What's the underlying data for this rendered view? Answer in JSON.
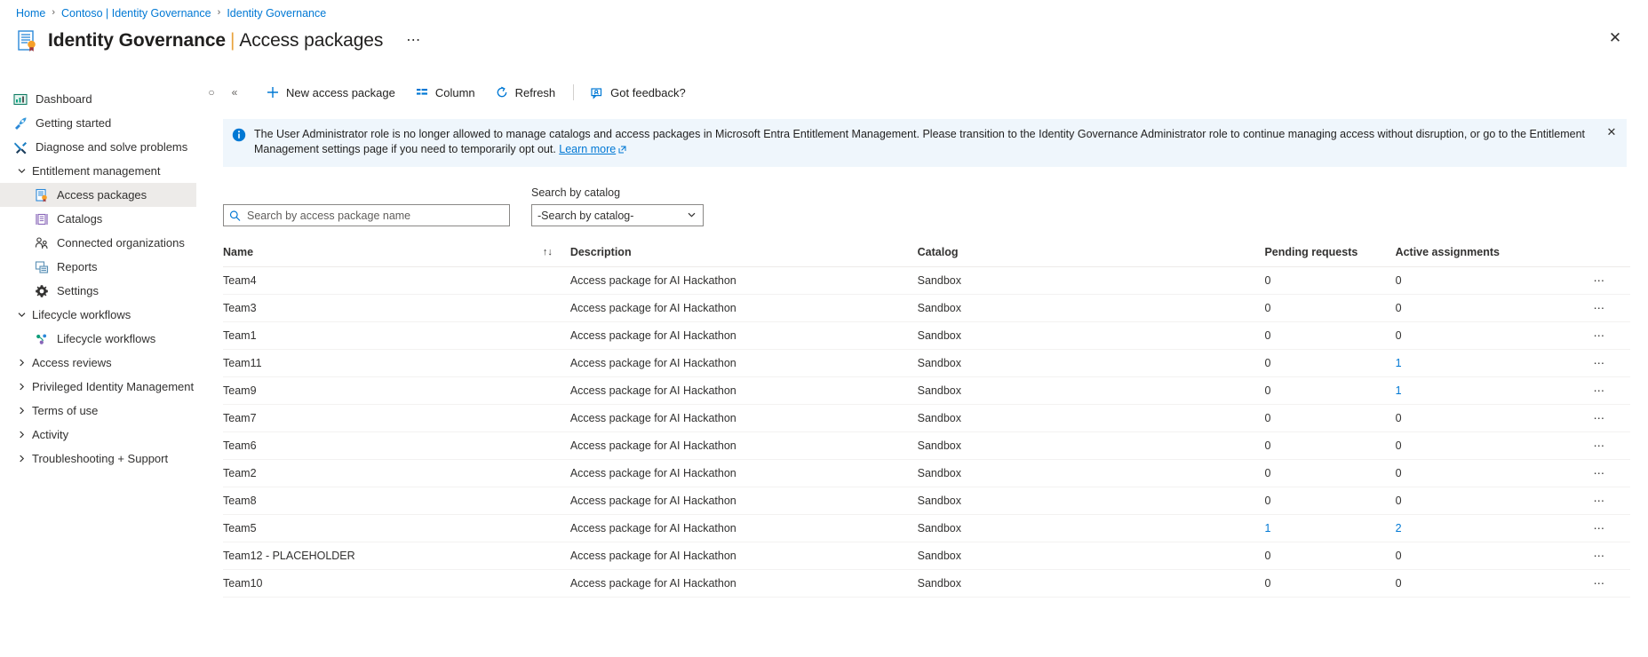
{
  "breadcrumb": {
    "items": [
      {
        "label": "Home"
      },
      {
        "label": "Contoso | Identity Governance"
      },
      {
        "label": "Identity Governance"
      }
    ],
    "separator": "›"
  },
  "header": {
    "title_main": "Identity Governance",
    "title_separator": "|",
    "title_sub": "Access packages",
    "overflow_label": "⋯",
    "close_label": "✕",
    "icon": "access-package-icon"
  },
  "sidebar": {
    "collapse_label": "«",
    "pin_label": "○",
    "items": [
      {
        "label": "Dashboard",
        "icon": "dashboard-icon",
        "type": "item",
        "selected": false
      },
      {
        "label": "Getting started",
        "icon": "rocket-icon",
        "type": "item",
        "selected": false
      },
      {
        "label": "Diagnose and solve problems",
        "icon": "tools-icon",
        "type": "item",
        "selected": false
      },
      {
        "label": "Entitlement management",
        "icon": "chevron-down-icon",
        "type": "group-open",
        "selected": false
      },
      {
        "label": "Access packages",
        "icon": "access-package-icon",
        "type": "child",
        "selected": true
      },
      {
        "label": "Catalogs",
        "icon": "catalog-icon",
        "type": "child",
        "selected": false
      },
      {
        "label": "Connected organizations",
        "icon": "people-icon",
        "type": "child",
        "selected": false
      },
      {
        "label": "Reports",
        "icon": "reports-icon",
        "type": "child",
        "selected": false
      },
      {
        "label": "Settings",
        "icon": "gear-icon",
        "type": "child",
        "selected": false
      },
      {
        "label": "Lifecycle workflows",
        "icon": "chevron-down-icon",
        "type": "group-open",
        "selected": false
      },
      {
        "label": "Lifecycle workflows",
        "icon": "workflow-icon",
        "type": "child",
        "selected": false
      },
      {
        "label": "Access reviews",
        "icon": "chevron-right-icon",
        "type": "group-closed",
        "selected": false
      },
      {
        "label": "Privileged Identity Management",
        "icon": "chevron-right-icon",
        "type": "group-closed",
        "selected": false
      },
      {
        "label": "Terms of use",
        "icon": "chevron-right-icon",
        "type": "group-closed",
        "selected": false
      },
      {
        "label": "Activity",
        "icon": "chevron-right-icon",
        "type": "group-closed",
        "selected": false
      },
      {
        "label": "Troubleshooting + Support",
        "icon": "chevron-right-icon",
        "type": "group-closed",
        "selected": false
      }
    ]
  },
  "toolbar": {
    "new_package_label": "New access package",
    "column_label": "Column",
    "refresh_label": "Refresh",
    "feedback_label": "Got feedback?"
  },
  "banner": {
    "text_part1": "The User Administrator role is no longer allowed to manage catalogs and access packages in Microsoft Entra Entitlement Management. Please transition to the Identity Governance Administrator role to continue managing access without disruption, or go to the Entitlement Management settings page if you need to temporarily opt out. ",
    "link_label": "Learn more",
    "close_label": "✕",
    "background": "#eff6fc",
    "accent": "#0078d4"
  },
  "filters": {
    "search_placeholder": "Search by access package name",
    "search_value": "",
    "catalog_label": "Search by catalog",
    "catalog_selected": "-Search by catalog-",
    "catalog_options": [
      "-Search by catalog-",
      "Sandbox"
    ]
  },
  "table": {
    "columns": [
      {
        "key": "name",
        "label": "Name",
        "sortable": true,
        "sort_icon": "↑↓"
      },
      {
        "key": "description",
        "label": "Description",
        "sortable": false
      },
      {
        "key": "catalog",
        "label": "Catalog",
        "sortable": false
      },
      {
        "key": "pending",
        "label": "Pending requests",
        "sortable": false
      },
      {
        "key": "active",
        "label": "Active assignments",
        "sortable": false
      }
    ],
    "row_menu_label": "⋯",
    "rows": [
      {
        "name": "Team4",
        "description": "Access package for AI Hackathon",
        "catalog": "Sandbox",
        "pending": "0",
        "active": "0"
      },
      {
        "name": "Team3",
        "description": "Access package for AI Hackathon",
        "catalog": "Sandbox",
        "pending": "0",
        "active": "0"
      },
      {
        "name": "Team1",
        "description": "Access package for AI Hackathon",
        "catalog": "Sandbox",
        "pending": "0",
        "active": "0"
      },
      {
        "name": "Team11",
        "description": "Access package for AI Hackathon",
        "catalog": "Sandbox",
        "pending": "0",
        "active": "1"
      },
      {
        "name": "Team9",
        "description": "Access package for AI Hackathon",
        "catalog": "Sandbox",
        "pending": "0",
        "active": "1"
      },
      {
        "name": "Team7",
        "description": "Access package for AI Hackathon",
        "catalog": "Sandbox",
        "pending": "0",
        "active": "0"
      },
      {
        "name": "Team6",
        "description": "Access package for AI Hackathon",
        "catalog": "Sandbox",
        "pending": "0",
        "active": "0"
      },
      {
        "name": "Team2",
        "description": "Access package for AI Hackathon",
        "catalog": "Sandbox",
        "pending": "0",
        "active": "0"
      },
      {
        "name": "Team8",
        "description": "Access package for AI Hackathon",
        "catalog": "Sandbox",
        "pending": "0",
        "active": "0"
      },
      {
        "name": "Team5",
        "description": "Access package for AI Hackathon",
        "catalog": "Sandbox",
        "pending": "1",
        "active": "2"
      },
      {
        "name": "Team12 - PLACEHOLDER",
        "description": "Access package for AI Hackathon",
        "catalog": "Sandbox",
        "pending": "0",
        "active": "0"
      },
      {
        "name": "Team10",
        "description": "Access package for AI Hackathon",
        "catalog": "Sandbox",
        "pending": "0",
        "active": "0"
      }
    ]
  }
}
